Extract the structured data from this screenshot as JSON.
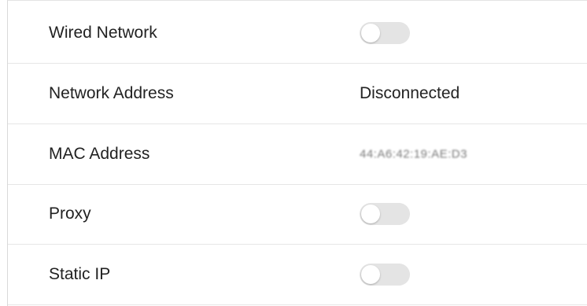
{
  "settings": {
    "rows": [
      {
        "label": "Wired Network",
        "type": "toggle",
        "on": false
      },
      {
        "label": "Network Address",
        "type": "text",
        "value": "Disconnected"
      },
      {
        "label": "MAC Address",
        "type": "text",
        "value": "44:A6:42:19:AE:D3",
        "obscured": true
      },
      {
        "label": "Proxy",
        "type": "toggle",
        "on": false
      },
      {
        "label": "Static IP",
        "type": "toggle",
        "on": false
      }
    ]
  },
  "colors": {
    "toggle_off_track": "#e4e4e4",
    "toggle_knob": "#ffffff",
    "divider": "#e6e6e6",
    "text": "#222222"
  }
}
